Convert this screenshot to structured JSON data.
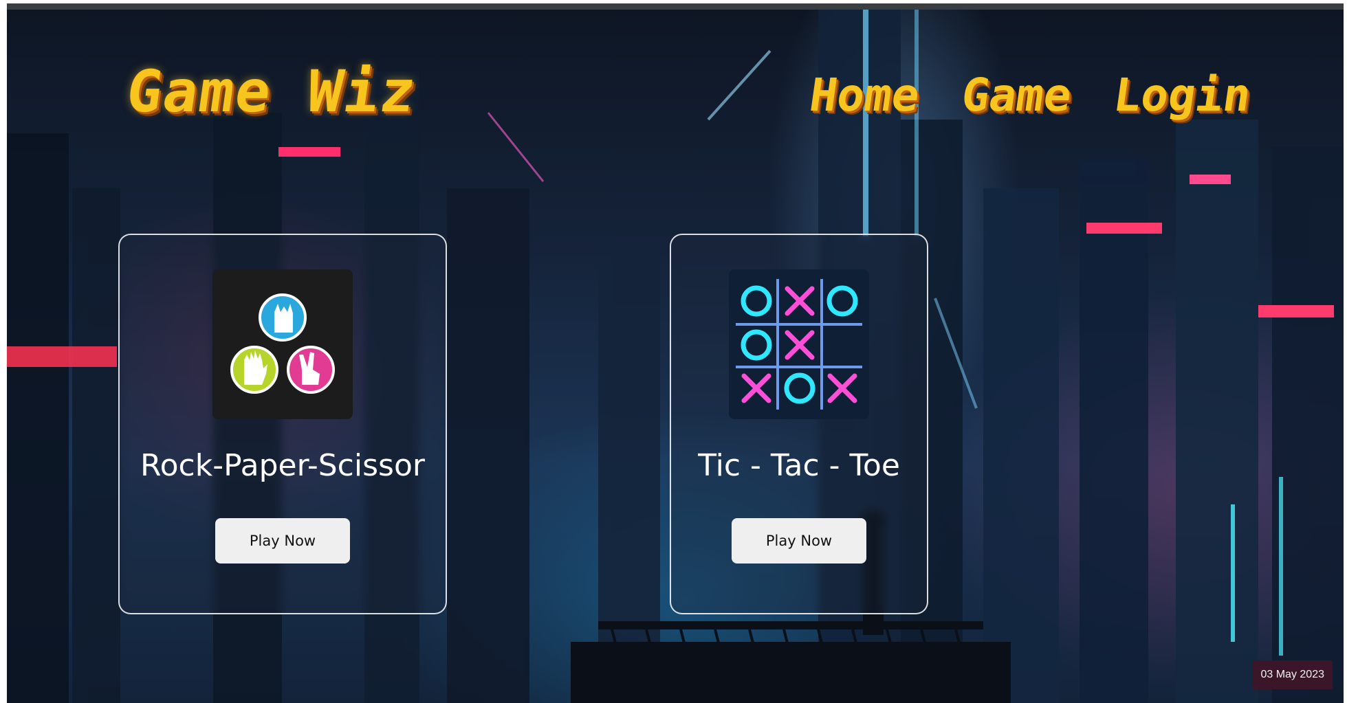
{
  "brand": {
    "logo_text": "Game Wiz"
  },
  "nav": [
    {
      "label": "Home"
    },
    {
      "label": "Game"
    },
    {
      "label": "Login"
    }
  ],
  "games": [
    {
      "title": "Rock-Paper-Scissor",
      "button_label": "Play Now",
      "icon": "rock-paper-scissors-icon"
    },
    {
      "title": "Tic - Tac - Toe",
      "button_label": "Play Now",
      "icon": "tic-tac-toe-icon"
    }
  ],
  "date_badge": "03 May 2023",
  "colors": {
    "logo": "#f7c51d",
    "logo_shadow": "#c0640f",
    "card_border": "#ffffff",
    "button_bg": "#efefef",
    "badge_bg": "#3a1628"
  }
}
